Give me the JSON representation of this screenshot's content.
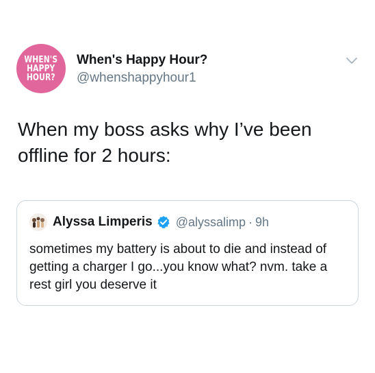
{
  "author": {
    "avatar_lines": [
      "WHEN'S",
      "HAPPY",
      "HOUR?"
    ],
    "display_name": "When's Happy Hour?",
    "handle": "@whenshappyhour1",
    "avatar_color": "#e0669c"
  },
  "menu": {
    "icon": "chevron-down-icon"
  },
  "tweet": {
    "text": "When my boss asks why I’ve been offline for 2 hours:"
  },
  "quoted_tweet": {
    "avatar_icon": "profile-photo",
    "display_name": "Alyssa Limperis",
    "verified_icon": "verified-badge-icon",
    "handle": "@alyssalimp",
    "separator": "·",
    "time": "9h",
    "text": "sometimes my battery is about to die and instead of getting a charger I go...you know what? nvm. take a rest girl you deserve it"
  },
  "colors": {
    "text_primary": "#14171a",
    "text_secondary": "#657786",
    "verified_blue": "#1da1f2",
    "border": "#ccd6dd"
  }
}
